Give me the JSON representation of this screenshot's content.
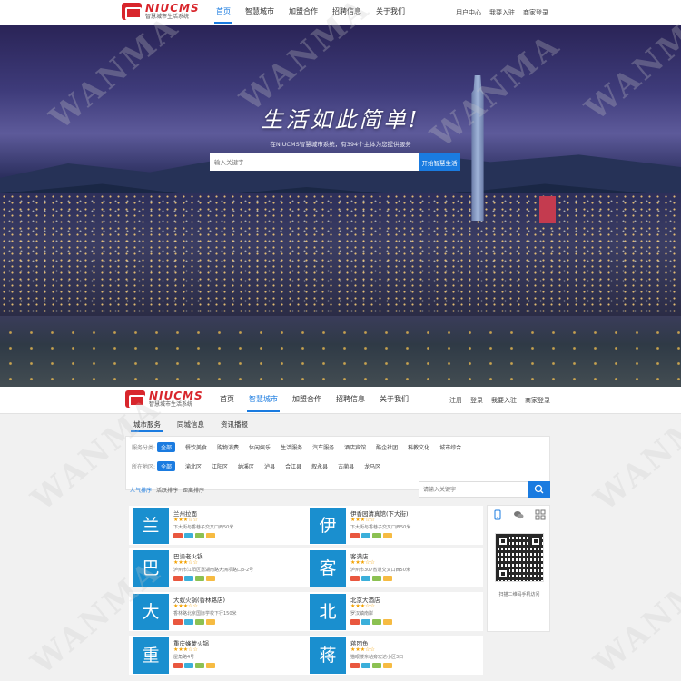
{
  "brand": {
    "name": "NIUCMS",
    "tagline": "智慧城市生活系统",
    "accent": "#d8262c",
    "primary": "#1a7be0"
  },
  "nav": {
    "items": [
      "首页",
      "智慧城市",
      "加盟合作",
      "招聘信息",
      "关于我们"
    ],
    "active": "首页"
  },
  "top_links": [
    "用户中心",
    "我要入驻",
    "商家登录"
  ],
  "hero": {
    "slogan": "生活如此简单!",
    "subtitle": "在NIUCMS智慧城市系统，有394个主体为您提供服务",
    "search_placeholder": "输入关键字",
    "search_button": "开始智慧生活"
  },
  "subheader": {
    "nav_items": [
      "首页",
      "智慧城市",
      "加盟合作",
      "招聘信息",
      "关于我们"
    ],
    "active": "智慧城市",
    "links": [
      "注册",
      "登录",
      "我要入驻",
      "商家登录"
    ]
  },
  "content_tabs": [
    "城市服务",
    "同城信息",
    "资讯播报"
  ],
  "filters": {
    "category_label": "服务分类:",
    "categories": [
      "全部",
      "餐饮美食",
      "购物消费",
      "休闲娱乐",
      "生活服务",
      "汽车服务",
      "酒店宾馆",
      "酷企社团",
      "科教文化",
      "城市综合"
    ],
    "area_label": "所在地区:",
    "areas": [
      "全部",
      "渝北区",
      "江阳区",
      "纳溪区",
      "泸县",
      "合江县",
      "叙永县",
      "古蔺县",
      "龙马区"
    ]
  },
  "sort": [
    "人气排序",
    "活跃排序",
    "距离排序"
  ],
  "list_search_placeholder": "请输入关键字",
  "cards": [
    {
      "icon": "兰",
      "title": "兰州拉面",
      "stars": "★★★☆☆",
      "addr": "下大街与香巷子交叉口西50米"
    },
    {
      "icon": "伊",
      "title": "伊香园清真馆(下大街)",
      "stars": "★★★☆☆",
      "addr": "下大街与香巷子交叉口西50米"
    },
    {
      "icon": "巴",
      "title": "巴渝老火锅",
      "stars": "★★★☆☆",
      "addr": "泸州市江阳区嘉湖南路大洲坝路口3-2号"
    },
    {
      "icon": "客",
      "title": "客满店",
      "stars": "★★★☆☆",
      "addr": "泸州市307省道交叉口西50米"
    },
    {
      "icon": "大",
      "title": "大蚁火锅(香林路店)",
      "stars": "★★★☆☆",
      "addr": "香林路北京国际学校下行150米"
    },
    {
      "icon": "北",
      "title": "北京大酒店",
      "stars": "★★★☆☆",
      "addr": "罗汉镇南岸"
    },
    {
      "icon": "重",
      "title": "重庆蜂蒙火锅",
      "stars": "★★★☆☆",
      "addr": "屋角路4号"
    },
    {
      "icon": "蒋",
      "title": "蒋团鱼",
      "stars": "★★★☆☆",
      "addr": "猫眼楼东站旁宏达小区3口"
    }
  ],
  "tag_colors": [
    "#e9573f",
    "#3bafda",
    "#8cc152",
    "#f6bb42"
  ],
  "side": {
    "icons": [
      "mobile-icon",
      "wechat-icon",
      "app-grid-icon"
    ],
    "caption": "扫描二维码手机访问"
  },
  "watermark": "WANMA"
}
